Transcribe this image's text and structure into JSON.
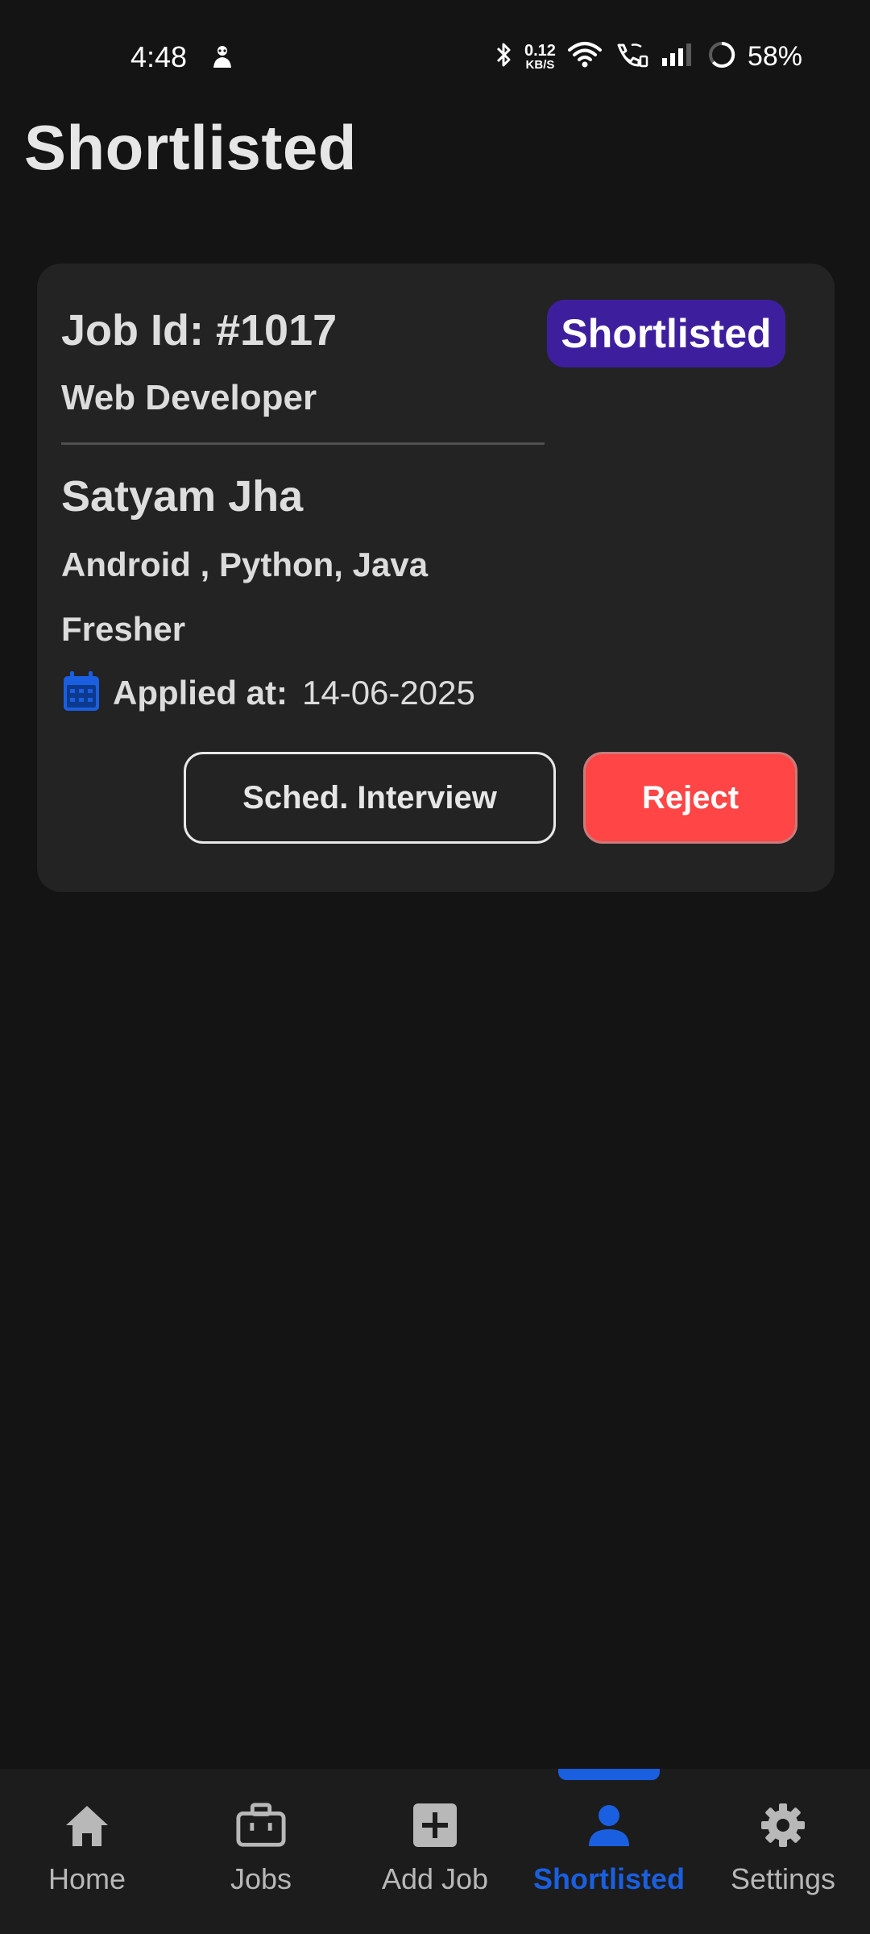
{
  "status_bar": {
    "time": "4:48",
    "net_speed_value": "0.12",
    "net_speed_unit": "KB/S",
    "battery": "58%"
  },
  "page": {
    "title": "Shortlisted"
  },
  "card": {
    "job_id": "Job Id: #1017",
    "job_title": "Web Developer",
    "status": "Shortlisted",
    "candidate_name": "Satyam Jha",
    "skills": "Android , Python, Java",
    "experience": "Fresher",
    "applied_label": "Applied at:",
    "applied_date": "14-06-2025",
    "interview_button": "Sched. Interview",
    "reject_button": "Reject"
  },
  "colors": {
    "accent": "#1a5fe0",
    "status_chip": "#3d1f9e",
    "reject": "#ff4545",
    "background": "#141414",
    "card": "#232323"
  },
  "nav": {
    "active": "Shortlisted",
    "items": [
      {
        "label": "Home",
        "icon": "home-icon"
      },
      {
        "label": "Jobs",
        "icon": "briefcase-icon"
      },
      {
        "label": "Add Job",
        "icon": "add-box-icon"
      },
      {
        "label": "Shortlisted",
        "icon": "person-icon"
      },
      {
        "label": "Settings",
        "icon": "gear-icon"
      }
    ]
  }
}
